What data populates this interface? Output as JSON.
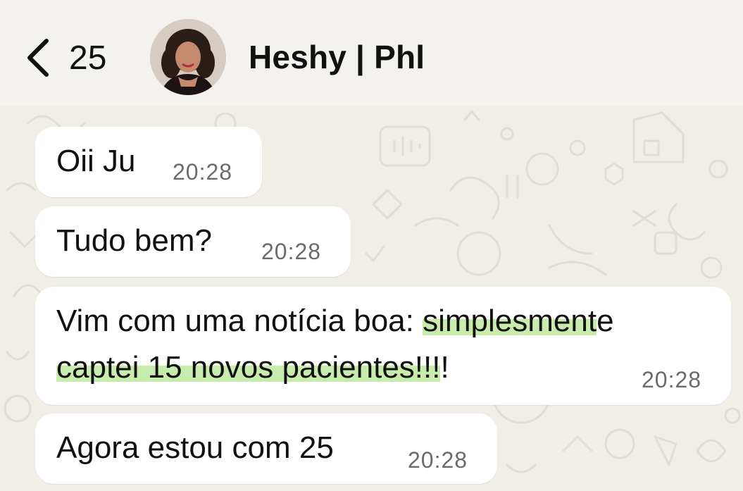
{
  "header": {
    "back_count": "25",
    "contact_name": "Heshy | Phl",
    "back_icon": "chevron-left-icon",
    "avatar_icon": "contact-avatar"
  },
  "colors": {
    "background": "#f1eee8",
    "bubble": "#ffffff",
    "highlight": "#c7ecab",
    "time": "#6b6b6b"
  },
  "messages": [
    {
      "text": "Oii Ju",
      "time": "20:28"
    },
    {
      "text": "Tudo bem?",
      "time": "20:28"
    },
    {
      "line1_plain": "Vim com uma notícia boa: ",
      "line1_highlight": "simplesment",
      "line1_tail": "e",
      "line2_highlight": "captei 15 novos pacientes!!!",
      "line2_tail": "!",
      "time": "20:28"
    },
    {
      "text": "Agora estou com 25",
      "time": "20:28"
    }
  ]
}
